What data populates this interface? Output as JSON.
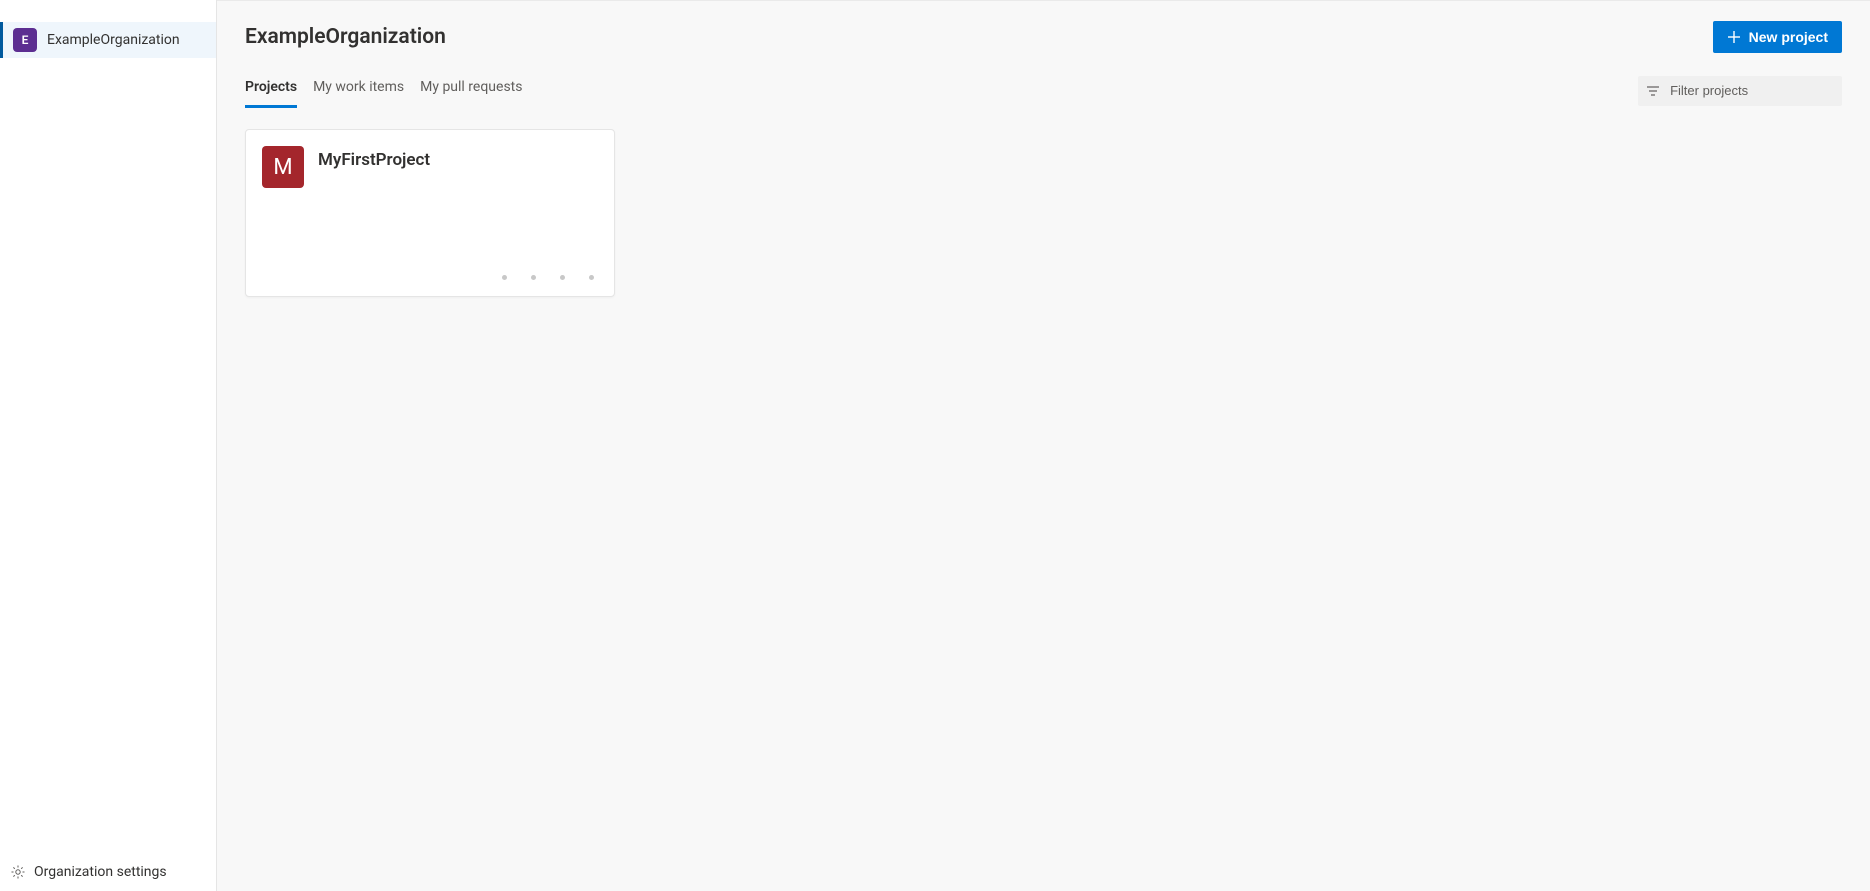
{
  "sidebar": {
    "org": {
      "avatar_letter": "E",
      "label": "ExampleOrganization",
      "avatar_color": "#5c2e91"
    },
    "footer": {
      "label": "Organization settings"
    }
  },
  "header": {
    "title": "ExampleOrganization",
    "new_project_label": "New project"
  },
  "tabs": {
    "items": [
      {
        "label": "Projects",
        "active": true
      },
      {
        "label": "My work items",
        "active": false
      },
      {
        "label": "My pull requests",
        "active": false
      }
    ],
    "filter_placeholder": "Filter projects"
  },
  "projects": [
    {
      "name": "MyFirstProject",
      "avatar_letter": "M",
      "avatar_color": "#a4262c"
    }
  ]
}
